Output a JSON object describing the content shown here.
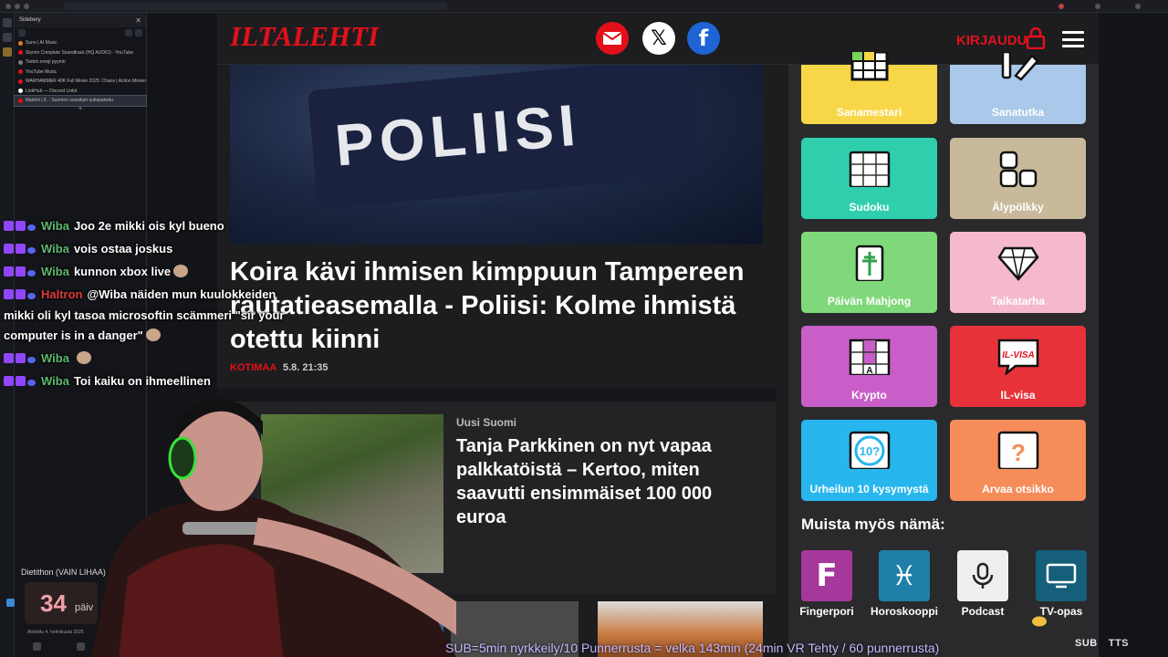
{
  "sidebery": {
    "title": "Sidebery",
    "tabs": [
      {
        "label": "Suno | AI Music",
        "color": "#e67e22",
        "active": false
      },
      {
        "label": "Skyrim Complete Soundtrack (HQ AUDIO) - YouTube",
        "color": "#e3101a",
        "active": false
      },
      {
        "label": "Twitch emoji pyyntö",
        "color": "#7a7a7a",
        "active": false
      },
      {
        "label": "YouTube Music",
        "color": "#e3101a",
        "active": false
      },
      {
        "label": "WARHAMMER 40K Full Movie 2025: Chaos | Action Movies",
        "color": "#e3101a",
        "active": false
      },
      {
        "label": "LinkHub — Discord Linkit",
        "color": "#ffffff",
        "active": false
      },
      {
        "label": "Iltalehti | IL - Suomen suosituin uutispalvelu",
        "color": "#e3101a",
        "active": true
      }
    ],
    "plus": "+"
  },
  "widget": {
    "label": "Dietithon (VAIN LIHAA)",
    "number": "34",
    "unit": "päiv",
    "sub": "Aloitettu 4. helmikuuta 2025"
  },
  "header": {
    "logo": "ILTALEHTI",
    "login": "KIRJAUDU",
    "colors": {
      "brand": "#e3101a",
      "facebook": "#1e64d4"
    }
  },
  "hero": {
    "image_text": "POLIISI",
    "title": "Koira kävi ihmisen kimppuun Tampereen rautatieasemalla - Poliisi: Kolme ihmistä otettu kiinni",
    "category": "KOTIMAA",
    "date": "5.8. 21:35"
  },
  "article2": {
    "source": "Uusi Suomi",
    "title": "Tanja Parkkinen on nyt vapaa palkkatöistä – Kertoo, miten saavutti ensimmäiset 100 000 euroa"
  },
  "games": [
    {
      "label": "Sanamestari",
      "color": "#f7d648",
      "icon": "grid-icon"
    },
    {
      "label": "Sanatutka",
      "color": "#a9c8ea",
      "icon": "pencil-icon"
    },
    {
      "label": "Sudoku",
      "color": "#2fcfae",
      "icon": "sudoku-icon"
    },
    {
      "label": "Älypölkky",
      "color": "#c8b99b",
      "icon": "blocks-icon"
    },
    {
      "label": "Päivän Mahjong",
      "color": "#7fd87a",
      "icon": "mahjong-icon"
    },
    {
      "label": "Taikatarha",
      "color": "#f5b8cc",
      "icon": "diamond-icon"
    },
    {
      "label": "Krypto",
      "color": "#c95ec8",
      "icon": "crossword-icon"
    },
    {
      "label": "IL-visa",
      "color": "#e8323a",
      "icon": "ilvisa-icon"
    },
    {
      "label": "Urheilun 10 kysymystä",
      "color": "#27b6ee",
      "icon": "ten-question-icon"
    },
    {
      "label": "Arvaa otsikko",
      "color": "#f58c5a",
      "icon": "question-icon"
    }
  ],
  "game_icon_text": {
    "ilvisa": "IL-VISA",
    "ten": "10?",
    "question": "?",
    "krypto_a": "A"
  },
  "muista": {
    "title": "Muista myös nämä:",
    "apps": [
      {
        "label": "Fingerpori",
        "color": "#a5389a",
        "icon": "fingerpori-icon",
        "glyph": "F"
      },
      {
        "label": "Horoskooppi",
        "color": "#1f7fa8",
        "icon": "pisces-icon",
        "glyph": "♓"
      },
      {
        "label": "Podcast",
        "color": "#eeeeee",
        "icon": "microphone-icon",
        "glyph": ""
      },
      {
        "label": "TV-opas",
        "color": "#155f7a",
        "icon": "tv-icon",
        "glyph": ""
      }
    ]
  },
  "chat": [
    {
      "user": "Wiba",
      "color": "#5fb96f",
      "text": "Joo 2e mikki ois kyl bueno",
      "emote": false
    },
    {
      "user": "Wiba",
      "color": "#5fb96f",
      "text": "vois ostaa joskus",
      "emote": false
    },
    {
      "user": "Wiba",
      "color": "#5fb96f",
      "text": "kunnon xbox live",
      "emote": true
    },
    {
      "user": "Haltron",
      "color": "#e33b3b",
      "text": "@Wiba näiden mun kuulokkeiden",
      "emote": false
    },
    {
      "user": "",
      "color": "",
      "text": "mikki oli kyl tasoa microsoftin scämmeri \"sir your",
      "emote": false
    },
    {
      "user": "",
      "color": "",
      "text": "computer is in a danger\"",
      "emote": true
    },
    {
      "user": "Wiba",
      "color": "#5fb96f",
      "text": "",
      "emote": true
    },
    {
      "user": "Wiba",
      "color": "#5fb96f",
      "text": "Toi kaiku on ihmeellinen",
      "emote": false
    }
  ],
  "ticker": "SUB=5min nyrkkeily/10 Punnerrusta = velka 143min (24min VR Tehty / 60 punnerrusta)",
  "subtts": {
    "sub": "SUB",
    "tts": "TTS"
  }
}
